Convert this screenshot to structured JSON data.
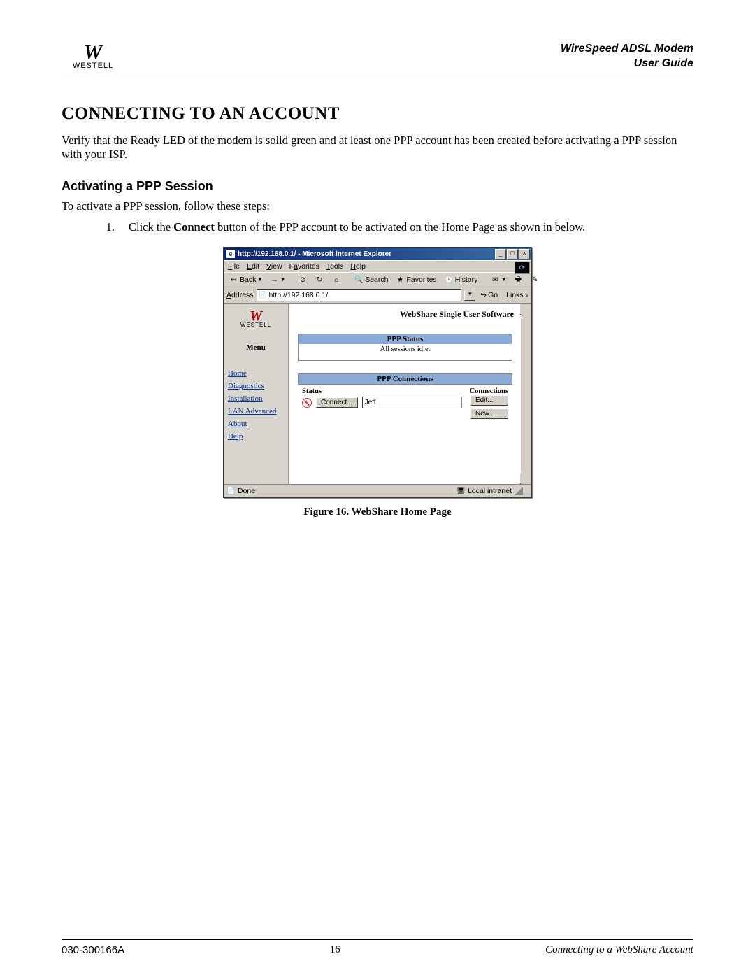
{
  "header": {
    "brand": "WESTELL",
    "product_line1": "WireSpeed ADSL Modem",
    "product_line2": "User Guide"
  },
  "chapter_title": "CONNECTING TO AN ACCOUNT",
  "intro_paragraph": "Verify that the Ready LED of the modem is solid green and at least one PPP account has been created before activating a PPP session with your ISP.",
  "section_title": "Activating a PPP Session",
  "section_intro": "To activate a PPP session, follow these steps:",
  "step_1_prefix": "Click the ",
  "step_1_bold": "Connect",
  "step_1_suffix": " button of the PPP account to be activated on the Home Page as shown in below.",
  "figure_caption": "Figure 16. WebShare Home Page",
  "footer": {
    "doc_number": "030-300166A",
    "page_number": "16",
    "section_name": "Connecting to a WebShare Account"
  },
  "screenshot": {
    "titlebar": "http://192.168.0.1/ - Microsoft Internet Explorer",
    "menubar": {
      "file": "File",
      "edit": "Edit",
      "view": "View",
      "favorites": "Favorites",
      "tools": "Tools",
      "help": "Help"
    },
    "toolbar": {
      "back": "Back",
      "search": "Search",
      "favorites": "Favorites",
      "history": "History"
    },
    "addressbar": {
      "label": "Address",
      "value": "http://192.168.0.1/",
      "go": "Go",
      "links": "Links"
    },
    "sidebar": {
      "brand": "WESTELL",
      "menu_label": "Menu",
      "items": [
        "Home",
        "Diagnostics",
        "Installation",
        "LAN Advanced",
        "About",
        "Help"
      ]
    },
    "content": {
      "software_title": "WebShare Single User Software",
      "ppp_status_header": "PPP Status",
      "ppp_status_text": "All sessions idle.",
      "ppp_connections_header": "PPP Connections",
      "col_status": "Status",
      "col_connections": "Connections",
      "connect_btn": "Connect...",
      "row_value": "Jeff",
      "edit_btn": "Edit...",
      "new_btn": "New..."
    },
    "statusbar": {
      "done": "Done",
      "zone": "Local intranet"
    }
  }
}
